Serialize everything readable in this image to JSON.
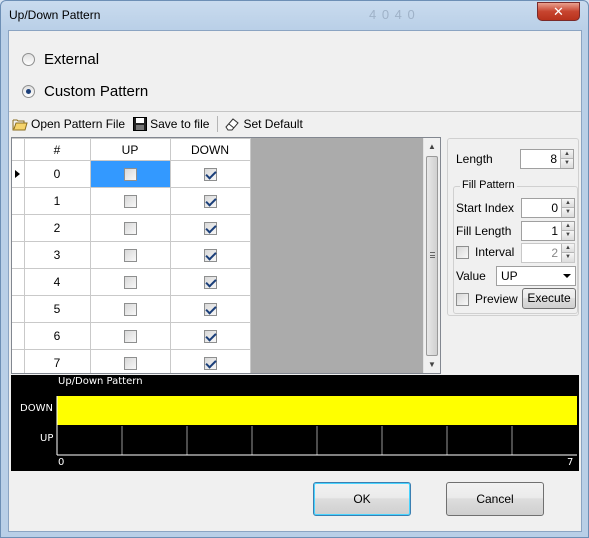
{
  "window": {
    "title": "Up/Down Pattern",
    "ghost_title": "4 0 4 0",
    "close_glyph": "✕"
  },
  "source": {
    "options": [
      {
        "label": "External",
        "checked": false
      },
      {
        "label": "Custom Pattern",
        "checked": true
      }
    ]
  },
  "toolbar": {
    "open_label": "Open Pattern File",
    "save_label": "Save to file",
    "default_label": "Set Default"
  },
  "grid": {
    "headers": [
      "#",
      "UP",
      "DOWN"
    ],
    "rows": [
      {
        "index": "0",
        "up": false,
        "down": true,
        "current": true
      },
      {
        "index": "1",
        "up": false,
        "down": true,
        "current": false
      },
      {
        "index": "2",
        "up": false,
        "down": true,
        "current": false
      },
      {
        "index": "3",
        "up": false,
        "down": true,
        "current": false
      },
      {
        "index": "4",
        "up": false,
        "down": true,
        "current": false
      },
      {
        "index": "5",
        "up": false,
        "down": true,
        "current": false
      },
      {
        "index": "6",
        "up": false,
        "down": true,
        "current": false
      },
      {
        "index": "7",
        "up": false,
        "down": true,
        "current": false
      }
    ]
  },
  "side": {
    "length_label": "Length",
    "length_value": "8",
    "fill_group_label": "Fill Pattern",
    "start_index_label": "Start Index",
    "start_index_value": "0",
    "fill_length_label": "Fill Length",
    "fill_length_value": "1",
    "interval_label": "Interval",
    "interval_value": "2",
    "interval_checked": false,
    "value_label": "Value",
    "value_selected": "UP",
    "preview_label": "Preview",
    "preview_checked": false,
    "execute_label": "Execute"
  },
  "chart_data": {
    "type": "area",
    "title": "Up/Down Pattern",
    "categories": [
      "DOWN",
      "UP"
    ],
    "x": [
      0,
      1,
      2,
      3,
      4,
      5,
      6,
      7
    ],
    "values": [
      "DOWN",
      "DOWN",
      "DOWN",
      "DOWN",
      "DOWN",
      "DOWN",
      "DOWN",
      "DOWN"
    ],
    "x_tick_labels": [
      "0",
      "7"
    ],
    "fill_color": "#ffff00",
    "background": "#000000",
    "grid_color": "#ffffff"
  },
  "footer": {
    "ok_label": "OK",
    "cancel_label": "Cancel"
  }
}
